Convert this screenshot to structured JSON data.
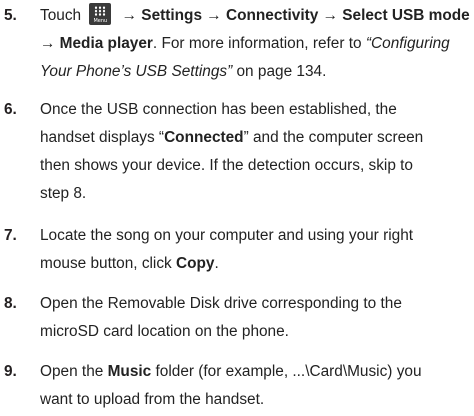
{
  "steps": [
    {
      "number": "5.",
      "touch": "Touch",
      "menu_icon_caption": "Menu",
      "path": "→ Settings → Connectivity → Select USB mode",
      "path2": "→ Media player",
      "text_after_path": ". For more information, refer to",
      "ref_title": "“Configuring Your Phone’s USB Settings”",
      "ref_page": "on page 134."
    },
    {
      "number": "6.",
      "text_a": "Once the USB connection has been established, the",
      "text_b": "handset displays “",
      "bold": "Connected",
      "text_c": "” and the computer screen",
      "text_d": "then shows your device. If the detection occurs, skip to",
      "text_e": "step 8."
    },
    {
      "number": "7.",
      "text_a": "Locate the song on your computer and using your right",
      "text_b": "mouse button, click ",
      "bold": "Copy",
      "text_c": "."
    },
    {
      "number": "8.",
      "text_a": "Open the Removable Disk drive corresponding to the",
      "text_b": "microSD card location on the phone."
    },
    {
      "number": "9.",
      "text_a": "Open the ",
      "bold": "Music",
      "text_b": " folder (for example, ...\\Card\\Music) you",
      "text_c": "want to upload from the handset."
    }
  ]
}
